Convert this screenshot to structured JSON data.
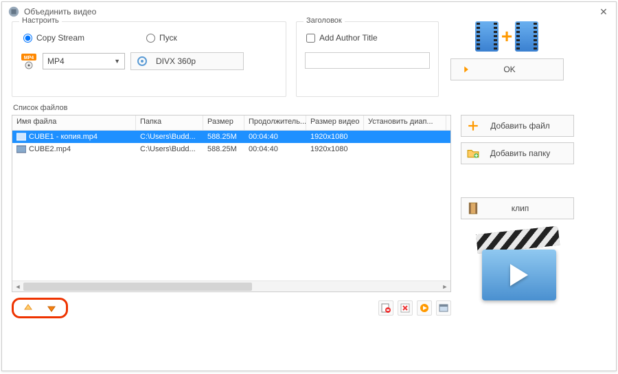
{
  "window": {
    "title": "Объединить видео"
  },
  "settings": {
    "panel_title": "Настроить",
    "copy_stream_label": "Copy Stream",
    "start_label": "Пуск",
    "format_value": "MP4",
    "profile_label": "DIVX 360p"
  },
  "header_panel": {
    "panel_title": "Заголовок",
    "checkbox_label": "Add Author Title",
    "input_value": ""
  },
  "buttons": {
    "ok": "OK",
    "add_file": "Добавить файл",
    "add_folder": "Добавить папку",
    "clip": "клип"
  },
  "filelist": {
    "label": "Список файлов",
    "columns": [
      "Имя файла",
      "Папка",
      "Размер",
      "Продолжитель...",
      "Размер видео",
      "Установить диап..."
    ],
    "rows": [
      {
        "name": "CUBE1 - копия.mp4",
        "folder": "C:\\Users\\Budd...",
        "size": "588.25M",
        "duration": "00:04:40",
        "vsize": "1920x1080",
        "range": "",
        "selected": true
      },
      {
        "name": "CUBE2.mp4",
        "folder": "C:\\Users\\Budd...",
        "size": "588.25M",
        "duration": "00:04:40",
        "vsize": "1920x1080",
        "range": "",
        "selected": false
      }
    ]
  }
}
